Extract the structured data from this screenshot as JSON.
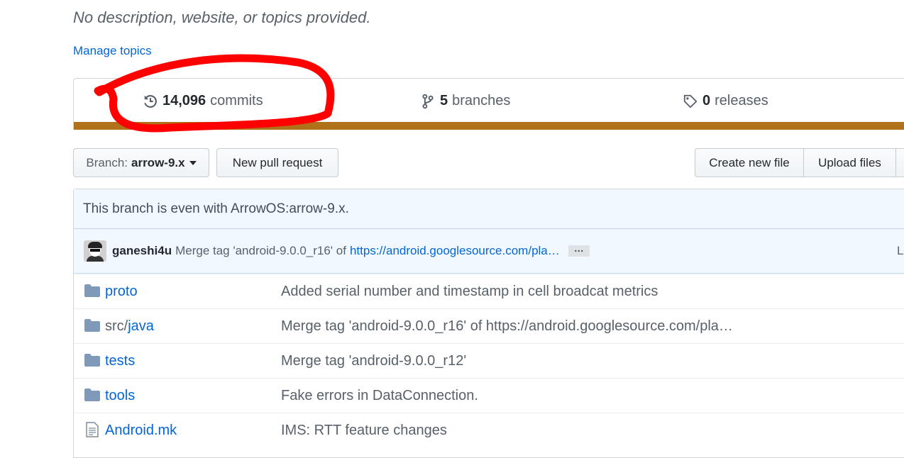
{
  "repo": {
    "description": "No description, website, or topics provided.",
    "manage_topics": "Manage topics"
  },
  "summary": {
    "commits_count": "14,096",
    "commits_label": "commits",
    "branches_count": "5",
    "branches_label": "branches",
    "releases_count": "0",
    "releases_label": "releases",
    "language_color": "#b07219"
  },
  "annotation": {
    "color": "#ff0000",
    "shape": "hand-drawn ellipse around commits count"
  },
  "toolbar": {
    "branch_prefix": "Branch:",
    "branch_name": "arrow-9.x",
    "new_pull_request": "New pull request",
    "create_new_file": "Create new file",
    "upload_files": "Upload files"
  },
  "branch_status": "This branch is even with ArrowOS:arrow-9.x.",
  "latest_commit": {
    "author": "ganeshi4u",
    "message": "Merge tag 'android-9.0.0_r16' of",
    "link": "https://android.googlesource.com/pla…",
    "ellipsis": "…",
    "right_text": "L"
  },
  "files": [
    {
      "type": "folder",
      "name_pre": "",
      "name": "proto",
      "message": "Added serial number and timestamp in cell broadcat metrics"
    },
    {
      "type": "folder",
      "name_pre": "src/",
      "name": "java",
      "message": "Merge tag 'android-9.0.0_r16' of https://android.googlesource.com/pla…"
    },
    {
      "type": "folder",
      "name_pre": "",
      "name": "tests",
      "message": "Merge tag 'android-9.0.0_r12'"
    },
    {
      "type": "folder",
      "name_pre": "",
      "name": "tools",
      "message": "Fake errors in DataConnection."
    },
    {
      "type": "file",
      "name_pre": "",
      "name": "Android.mk",
      "message": "IMS: RTT feature changes"
    }
  ]
}
